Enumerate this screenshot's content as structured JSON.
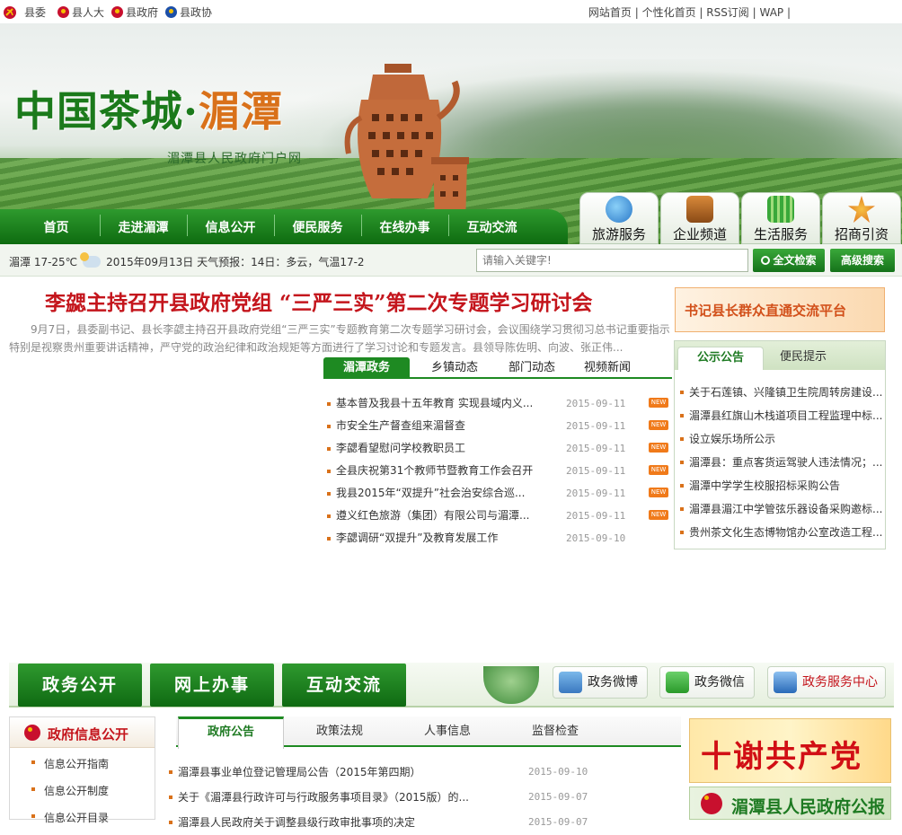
{
  "top": {
    "left_links": [
      "县委",
      "县人大",
      "县政府",
      "县政协"
    ],
    "right_links": "网站首页 | 个性化首页 | RSS订阅 | WAP |"
  },
  "banner": {
    "logo_main": "中国茶城·",
    "logo_place": "湄潭",
    "logo_sub": "湄潭县人民政府门户网"
  },
  "nav": [
    "首页",
    "走进湄潭",
    "信息公开",
    "便民服务",
    "在线办事",
    "互动交流"
  ],
  "services": [
    {
      "label": "旅游服务",
      "icon": "globe-icon",
      "color": "#3a8ad8"
    },
    {
      "label": "企业频道",
      "icon": "briefcase-icon",
      "color": "#b5651d"
    },
    {
      "label": "生活服务",
      "icon": "basket-icon",
      "color": "#3aa83a"
    },
    {
      "label": "招商引资",
      "icon": "medal-icon",
      "color": "#e0892a"
    }
  ],
  "infobar": {
    "weather": "湄潭 17-25℃",
    "forecast": "2015年09月13日 天气预报：14日：多云，气温17-2",
    "search_placeholder": "请输入关键字!",
    "search_button": "全文检索",
    "advanced_button": "高级搜索"
  },
  "headline": {
    "title": "李勰主持召开县政府党组 “三严三实”第二次专题学习研讨会",
    "summary": "9月7日，县委副书记、县长李勰主持召开县政府党组“三严三实”专题教育第二次专题学习研讨会，会议围绕学习贯彻习总书记重要指示特别是视察贵州重要讲话精神，严守党的政治纪律和政治规矩等方面进行了学习讨论和专题发言。县领导陈佐明、向波、张正伟..."
  },
  "news_tabs": [
    "湄潭政务",
    "乡镇动态",
    "部门动态",
    "视频新闻"
  ],
  "news": [
    {
      "title": "基本普及我县十五年教育 实现县域内义...",
      "date": "2015-09-11",
      "new": "NEW"
    },
    {
      "title": "市安全生产督查组来湄督查",
      "date": "2015-09-11",
      "new": "NEW"
    },
    {
      "title": "李勰看望慰问学校教职员工",
      "date": "2015-09-11",
      "new": "NEW"
    },
    {
      "title": "全县庆祝第31个教师节暨教育工作会召开",
      "date": "2015-09-11",
      "new": "NEW"
    },
    {
      "title": "我县2015年“双提升”社会治安综合巡...",
      "date": "2015-09-11",
      "new": "NEW"
    },
    {
      "title": "遵义红色旅游（集团）有限公司与湄潭...",
      "date": "2015-09-11",
      "new": "NEW"
    },
    {
      "title": "李勰调研“双提升”及教育发展工作",
      "date": "2015-09-10",
      "new": ""
    }
  ],
  "right": {
    "secretary_banner": "书记县长群众直通交流平台",
    "notice_tabs": [
      "公示公告",
      "便民提示"
    ],
    "notices": [
      "关于石莲镇、兴隆镇卫生院周转房建设...",
      "湄潭县红旗山木栈道项目工程监理中标...",
      "设立娱乐场所公示",
      "湄潭县：重点客货运驾驶人违法情况；...",
      "湄潭中学学生校服招标采购公告",
      "湄潭县湄江中学管弦乐器设备采购邀标...",
      "贵州茶文化生态博物馆办公室改造工程..."
    ]
  },
  "section": {
    "big_tabs": [
      "政务公开",
      "网上办事",
      "互动交流"
    ],
    "buttons": [
      {
        "label": "政务微博",
        "icon": "weibo-icon",
        "color": "#5a9ad8"
      },
      {
        "label": "政务微信",
        "icon": "wechat-icon",
        "color": "#4caf50"
      },
      {
        "label": "政务服务中心",
        "icon": "monitor-icon",
        "color": "#3a7ac8"
      }
    ]
  },
  "gov_info": {
    "title": "政府信息公开",
    "links": [
      "信息公开指南",
      "信息公开制度",
      "信息公开目录"
    ]
  },
  "bottom_tabs": [
    "政府公告",
    "政策法规",
    "人事信息",
    "监督检查"
  ],
  "announcements": [
    {
      "title": "湄潭县事业单位登记管理局公告（2015年第四期）",
      "date": "2015-09-10"
    },
    {
      "title": "关于《湄潭县行政许可与行政服务事项目录》（2015版）的...",
      "date": "2015-09-07"
    },
    {
      "title": "湄潭县人民政府关于调整县级行政审批事项的决定",
      "date": "2015-09-07"
    }
  ],
  "party_banner": "十谢共产党",
  "gazette": "湄潭县人民政府公报"
}
